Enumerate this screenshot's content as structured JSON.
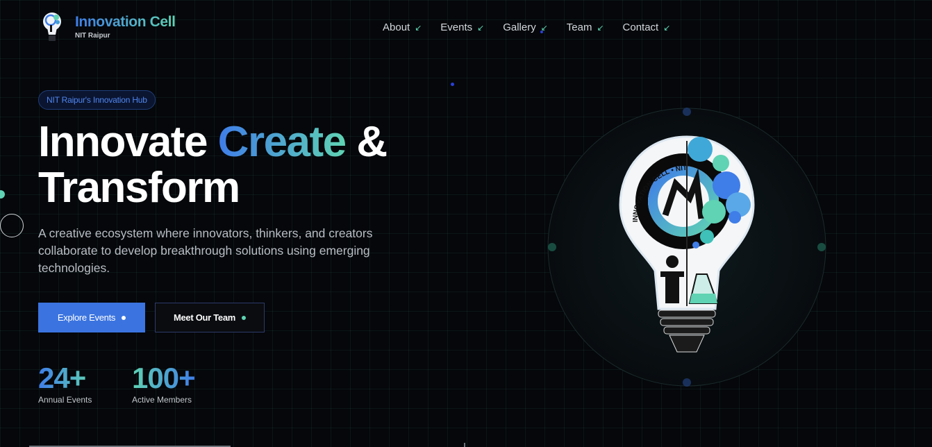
{
  "brand": {
    "title": "Innovation Cell",
    "subtitle": "NIT Raipur"
  },
  "nav": {
    "items": [
      {
        "label": "About"
      },
      {
        "label": "Events"
      },
      {
        "label": "Gallery"
      },
      {
        "label": "Team"
      },
      {
        "label": "Contact"
      }
    ],
    "arrow_icon": "arrow-down-left-icon"
  },
  "hero": {
    "badge": "NIT Raipur's Innovation Hub",
    "headline": {
      "word1": "Innovate",
      "word2": "Create",
      "word3": "&",
      "word4": "Transform"
    },
    "description": "A creative ecosystem where innovators, thinkers, and creators collaborate to develop breakthrough solutions using emerging technologies.",
    "primary_button": "Explore Events",
    "secondary_button": "Meet Our Team"
  },
  "stats": [
    {
      "value": "24+",
      "label": "Annual Events"
    },
    {
      "value": "100+",
      "label": "Active Members"
    }
  ],
  "logo_text": "INNOVATION CELL • NIT RAIPUR",
  "colors": {
    "background": "#05070a",
    "accent_blue": "#3f7de8",
    "accent_teal": "#5fd3b3",
    "button_primary": "#3b74e0"
  }
}
